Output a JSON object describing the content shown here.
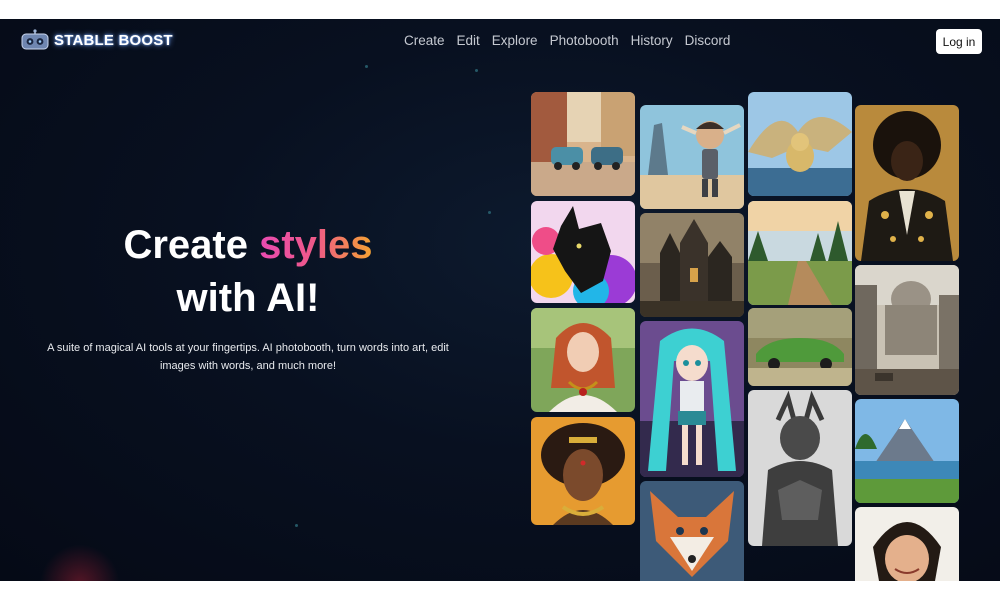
{
  "brand": {
    "name": "STABLE BOOST"
  },
  "nav": {
    "items": [
      "Create",
      "Edit",
      "Explore",
      "Photobooth",
      "History",
      "Discord"
    ],
    "login_label": "Log in"
  },
  "hero": {
    "line1_plain": "Create ",
    "line1_accent": "styles",
    "line2": "with AI!",
    "subtitle": "A suite of magical AI tools at your fingertips. AI photobooth, turn words into art, edit images with words, and much more!"
  },
  "colors": {
    "background": "#081020",
    "accent_gradient": [
      "#e94bb2",
      "#ef5a87",
      "#f5a431"
    ],
    "login_bg": "#ffffff"
  },
  "gallery": {
    "images": [
      "street-cars-image",
      "robot-boy-image",
      "winged-dog-image",
      "afro-man-image",
      "black-dog-image",
      "gothic-castle-image",
      "forest-road-image",
      "capitol-ruins-image",
      "redhead-woman-image",
      "anime-girl-image",
      "green-car-image",
      "african-queen-image",
      "armored-creature-image",
      "mountain-lake-image",
      "fox-image",
      "smiling-woman-image"
    ]
  }
}
